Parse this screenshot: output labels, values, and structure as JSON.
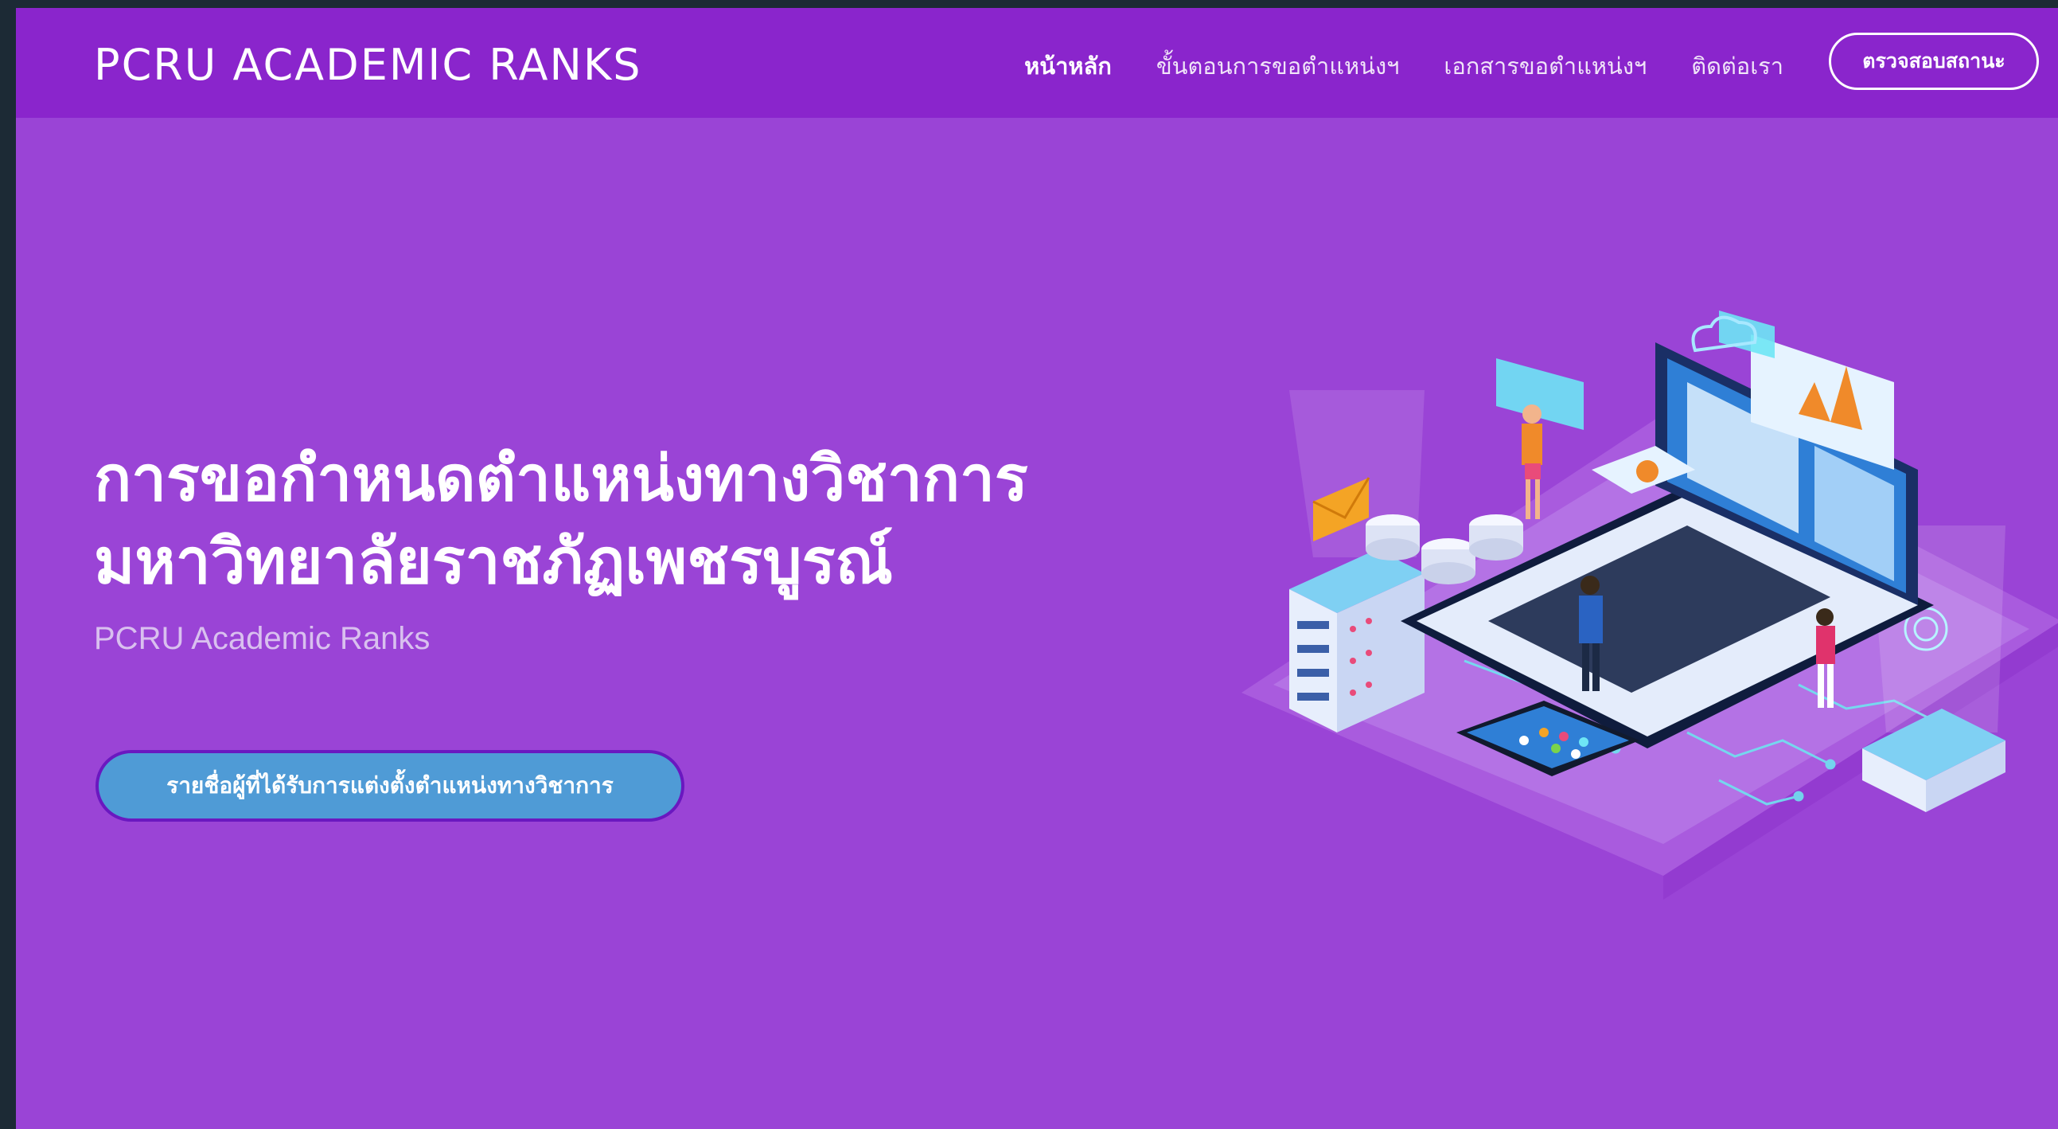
{
  "navbar": {
    "brand": "PCRU ACADEMIC RANKS",
    "links": [
      {
        "label": "หน้าหลัก"
      },
      {
        "label": "ขั้นตอนการขอตำแหน่งฯ"
      },
      {
        "label": "เอกสารขอตำแหน่งฯ"
      },
      {
        "label": "ติดต่อเรา"
      }
    ],
    "status_button": "ตรวจสอบสถานะ"
  },
  "hero": {
    "title_line1": "การขอกำหนดตำแหน่งทางวิชาการ",
    "title_line2": "มหาวิทยาลัยราชภัฏเพชรบูรณ์",
    "subtitle": "PCRU Academic Ranks",
    "cta_label": "รายชื่อผู้ที่ได้รับการแต่งตั้งตำแหน่งทางวิชาการ"
  },
  "colors": {
    "page_background": "#9a44d6",
    "navbar_background": "#8a25cc",
    "cta_background": "#4f9bd6",
    "outer_frame": "#1c2a35"
  }
}
